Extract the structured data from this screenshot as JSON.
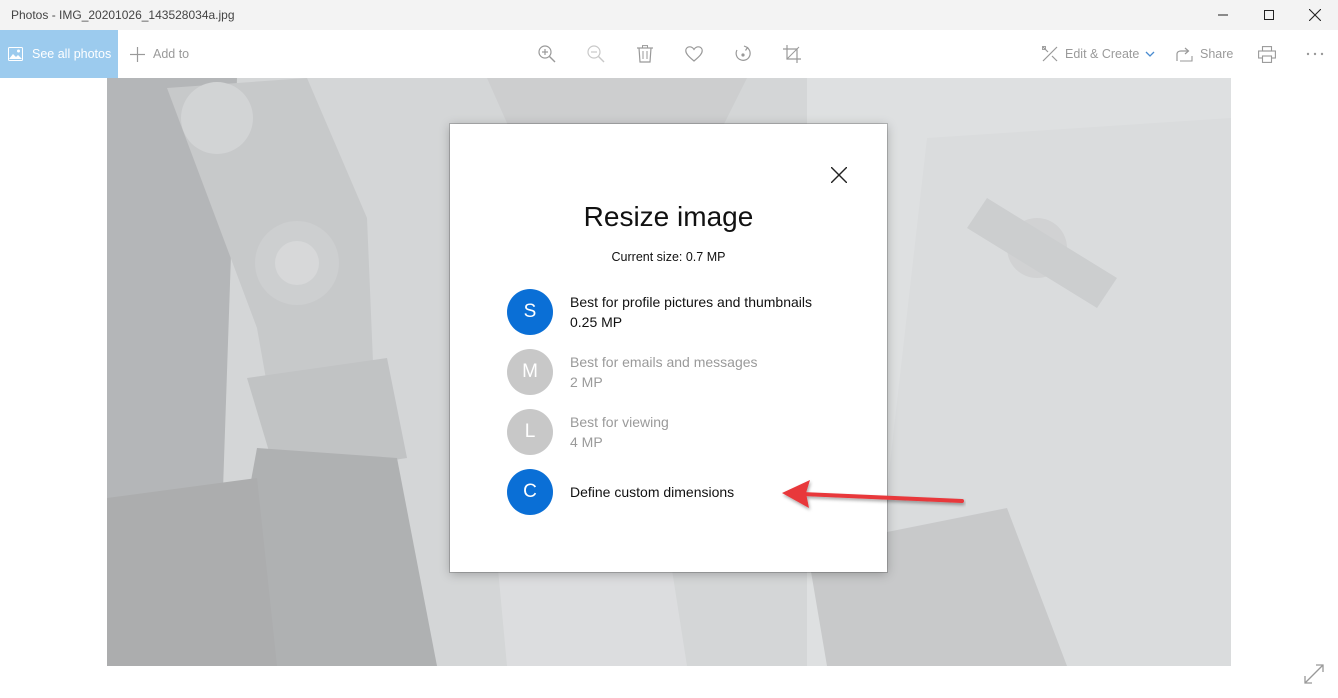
{
  "window": {
    "title": "Photos - IMG_20201026_143528034a.jpg"
  },
  "toolbar": {
    "see_all_photos": "See all photos",
    "add_to": "Add to",
    "edit_create": "Edit & Create",
    "share": "Share",
    "icons": [
      "zoom-in-icon",
      "zoom-out-icon",
      "delete-icon",
      "favorite-icon",
      "rotate-icon",
      "crop-icon",
      "print-icon",
      "more-icon"
    ]
  },
  "dialog": {
    "title": "Resize image",
    "current_size": "Current size: 0.7 MP",
    "options": [
      {
        "letter": "S",
        "line1": "Best for profile pictures and thumbnails",
        "line2": "0.25 MP",
        "enabled": true
      },
      {
        "letter": "M",
        "line1": "Best for emails and messages",
        "line2": "2 MP",
        "enabled": false
      },
      {
        "letter": "L",
        "line1": "Best for viewing",
        "line2": "4 MP",
        "enabled": false
      },
      {
        "letter": "C",
        "line1": "Define custom dimensions",
        "line2": "",
        "enabled": true
      }
    ]
  },
  "colors": {
    "accent": "#0a6fd6",
    "see_all_bg": "#9ccbee",
    "annotation_arrow": "#e8373a",
    "disabled_circle": "#c8c8c8"
  }
}
